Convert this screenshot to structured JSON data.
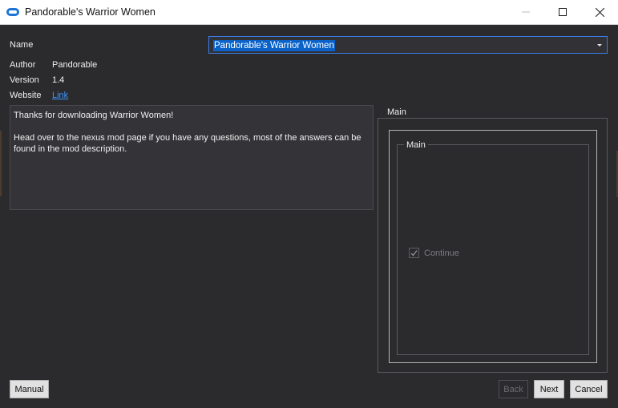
{
  "window": {
    "title": "Pandorable's Warrior Women",
    "icons": {
      "app": "mod-organizer-icon",
      "minimize": "minimize-icon",
      "maximize": "maximize-icon",
      "close": "close-icon"
    }
  },
  "info": {
    "name_label": "Name",
    "name_value": "Pandorable's Warrior Women",
    "author_label": "Author",
    "author_value": "Pandorable",
    "version_label": "Version",
    "version_value": "1.4",
    "website_label": "Website",
    "website_link": "Link"
  },
  "description": {
    "line1": "Thanks for downloading Warrior Women!",
    "line2": "Head over to the nexus mod page if you have any questions, most of the answers can be found in the mod description."
  },
  "steps": {
    "outer_group_label": "Main",
    "inner_group_label": "Main",
    "option": {
      "label": "Continue",
      "checked": true,
      "enabled": false
    }
  },
  "buttons": {
    "manual": "Manual",
    "back": "Back",
    "next": "Next",
    "cancel": "Cancel"
  },
  "colors": {
    "background": "#2b2a2d",
    "accent": "#0a62c9",
    "link": "#3d9aff"
  }
}
